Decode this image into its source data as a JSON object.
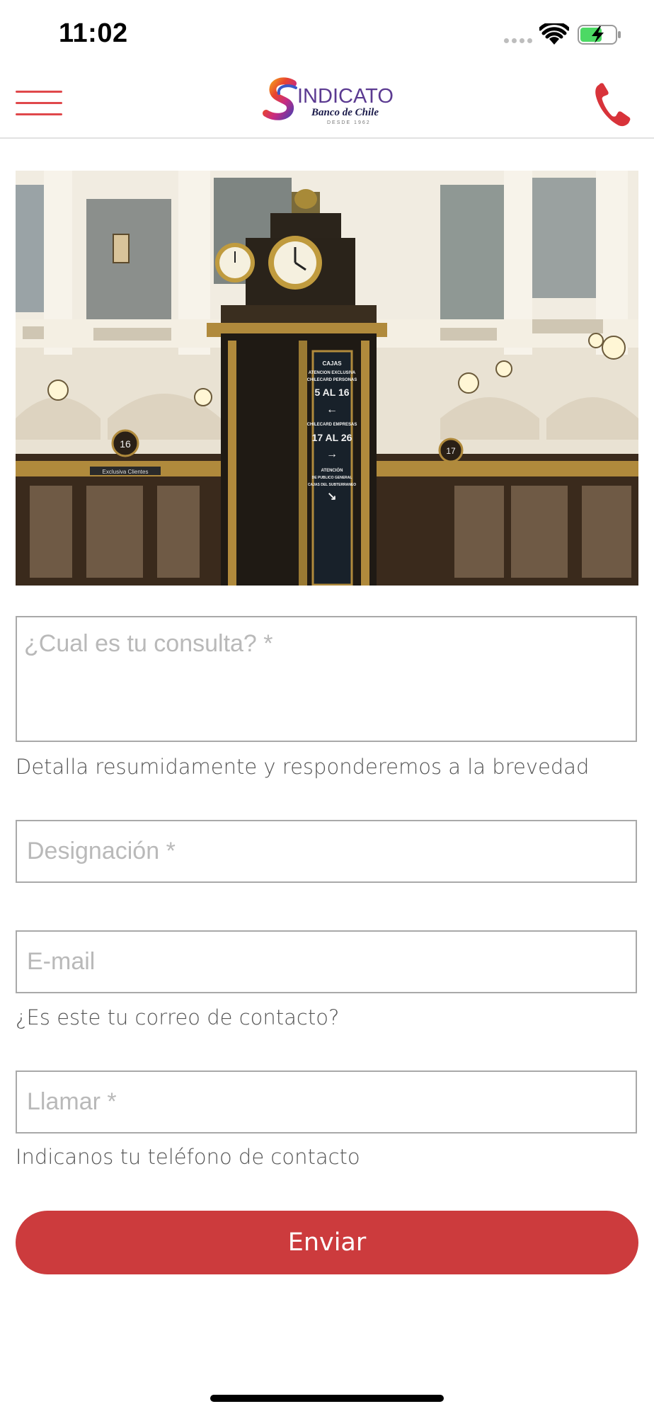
{
  "status_bar": {
    "time": "11:02",
    "icons": [
      "signal-icon",
      "wifi-icon",
      "battery-charging-icon"
    ],
    "battery_color": "#4cd964"
  },
  "header": {
    "menu_icon": "hamburger-menu-icon",
    "logo": {
      "main": "INDICATO",
      "sub": "Banco de Chile",
      "tiny": "DESDE 1962"
    },
    "phone_icon": "phone-icon",
    "accent_color": "#e0484b"
  },
  "hero": {
    "image": "bank-hall-clock-photo",
    "sign_lines": [
      "CAJAS",
      "ATENCION EXCLUSIVA",
      "CHILECARD PERSONAS",
      "5 AL 16",
      "CHILECARD EMPRESAS",
      "17 AL 26",
      "ATENCIÓN",
      "DE PUBLICO GENERAL",
      "CAJAS DEL SUBTERRANEO"
    ],
    "booth_label": "Exclusiva Clientes",
    "booth_numbers": [
      "16",
      "17"
    ]
  },
  "form": {
    "query": {
      "placeholder": "¿Cual es tu consulta? *",
      "value": "",
      "helper": "Detalla resumidamente y responderemos a la brevedad"
    },
    "designation": {
      "placeholder": "Designación *",
      "value": ""
    },
    "email": {
      "placeholder": "E-mail",
      "value": "",
      "helper": "¿Es este tu correo de contacto?"
    },
    "phone": {
      "placeholder": "Llamar *",
      "value": "",
      "helper": "Indicanos tu teléfono de contacto"
    },
    "submit_label": "Enviar",
    "submit_color": "#cc3b3d"
  }
}
